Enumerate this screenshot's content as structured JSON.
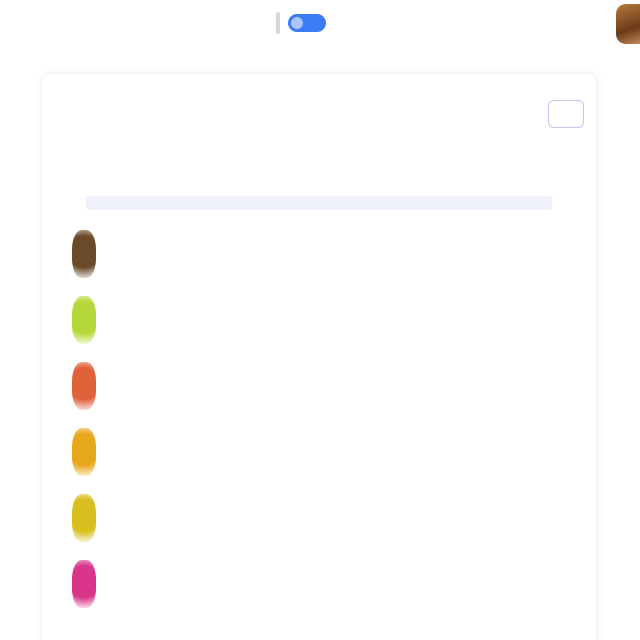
{
  "topbar": {
    "left_label": "",
    "toggle_state": "on"
  },
  "card": {
    "title": "",
    "close_label": "",
    "section": {
      "label": "",
      "link": ""
    },
    "items": [
      {
        "title": "",
        "description": "",
        "meta": "",
        "avatar_color": "#6b4a2a"
      },
      {
        "title": "",
        "description": "",
        "meta": "",
        "avatar_color": "#b7d83a"
      },
      {
        "title": "",
        "description": "",
        "meta": "",
        "avatar_color": "#e0623a"
      },
      {
        "title": "",
        "description": "",
        "meta": "",
        "avatar_color": "#e8a81c"
      },
      {
        "title": "",
        "description": "",
        "meta": "",
        "avatar_color": "#d8bf1e"
      },
      {
        "title": "",
        "description": "",
        "meta": "",
        "avatar_color": "#d9358a"
      }
    ]
  },
  "colors": {
    "accent": "#5b5fd6",
    "toggle": "#3d7cf5",
    "section_line": "#eef0fb"
  }
}
